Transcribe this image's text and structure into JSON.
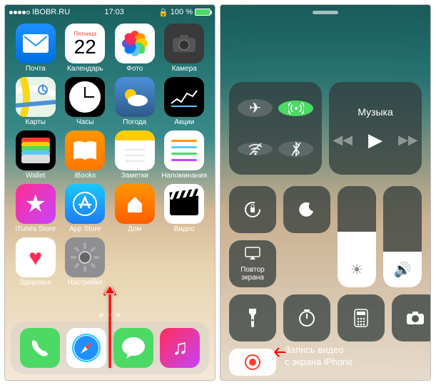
{
  "home": {
    "status": {
      "carrier": "IBOBR.RU",
      "time": "17:03",
      "battery_pct": "100 %"
    },
    "calendar": {
      "day": "Пятница",
      "date": "22"
    },
    "apps": [
      {
        "id": "mail",
        "label": "Почта"
      },
      {
        "id": "calendar",
        "label": "Календарь"
      },
      {
        "id": "photos",
        "label": "Фото"
      },
      {
        "id": "camera",
        "label": "Камера"
      },
      {
        "id": "maps",
        "label": "Карты"
      },
      {
        "id": "clock",
        "label": "Часы"
      },
      {
        "id": "weather",
        "label": "Погода"
      },
      {
        "id": "stocks",
        "label": "Акции"
      },
      {
        "id": "wallet",
        "label": "Wallet"
      },
      {
        "id": "ibooks",
        "label": "iBooks"
      },
      {
        "id": "notes",
        "label": "Заметки"
      },
      {
        "id": "reminders",
        "label": "Напоминания"
      },
      {
        "id": "itunes",
        "label": "iTunes Store"
      },
      {
        "id": "appstore",
        "label": "App Store"
      },
      {
        "id": "home",
        "label": "Дом"
      },
      {
        "id": "video",
        "label": "Видео"
      },
      {
        "id": "health",
        "label": "Здоровье"
      },
      {
        "id": "settings",
        "label": "Настройки"
      }
    ],
    "dock": [
      "phone",
      "safari",
      "messages",
      "music"
    ]
  },
  "cc": {
    "music_label": "Музыка",
    "mirror_label": "Повтор\nэкрана",
    "brightness_pct": 55,
    "volume_pct": 35,
    "toggles": {
      "airplane": false,
      "cellular": true,
      "wifi": false,
      "bluetooth": false
    },
    "annotation": "Запись видео\nс экрана iPhone"
  }
}
